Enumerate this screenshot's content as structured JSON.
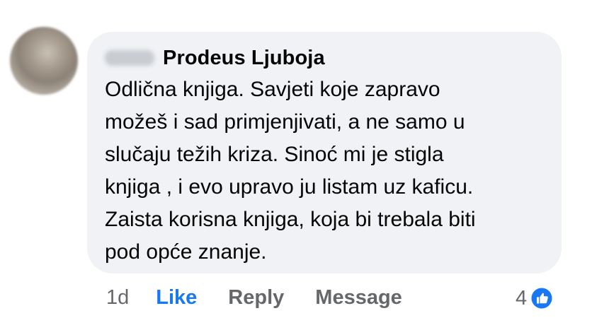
{
  "comment": {
    "author": "Prodeus Ljuboja",
    "lines": [
      "Odlična knjiga. Savjeti koje zapravo",
      "možeš i sad primjenjivati, a ne samo u",
      "slučaju težih kriza. Sinoć mi je stigla",
      "knjiga , i evo upravo ju listam uz kaficu.",
      "Zaista korisna knjiga, koja bi trebala biti",
      "pod opće znanje."
    ]
  },
  "actions": {
    "time": "1d",
    "like_label": "Like",
    "reply_label": "Reply",
    "message_label": "Message"
  },
  "reactions": {
    "count": "4",
    "icon": "like-reaction-icon"
  },
  "colors": {
    "bubble": "#f0f2f5",
    "accent": "#1877f2",
    "meta": "#65676b",
    "text": "#050505"
  }
}
